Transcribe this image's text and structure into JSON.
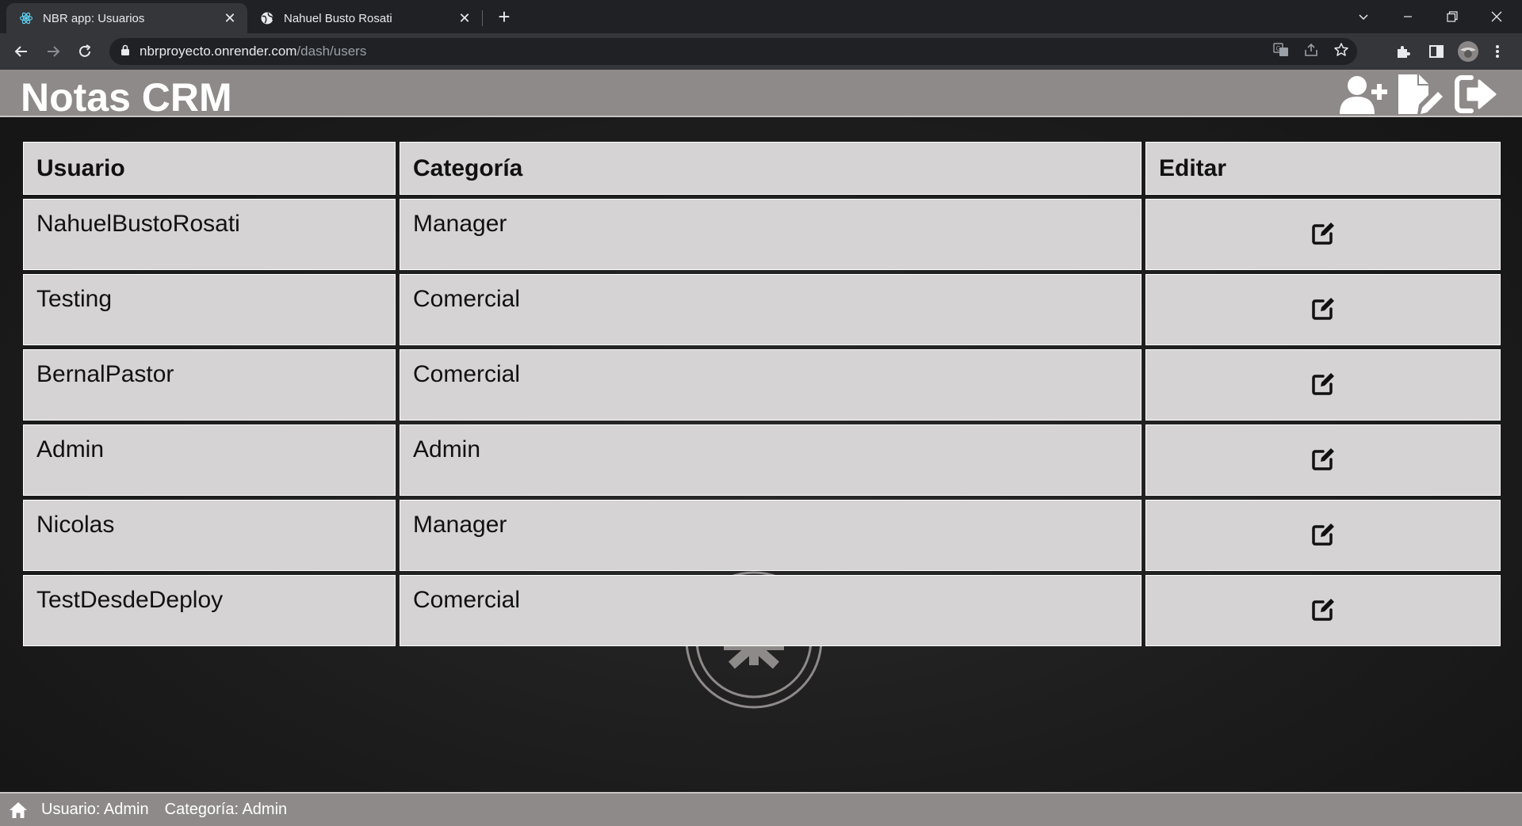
{
  "browser": {
    "tabs": [
      {
        "title": "NBR app: Usuarios",
        "active": true,
        "favicon": "react-icon"
      },
      {
        "title": "Nahuel Busto Rosati",
        "active": false,
        "favicon": "globe-icon"
      }
    ],
    "address": {
      "host": "nbrproyecto.onrender.com",
      "path": "/dash/users"
    }
  },
  "header": {
    "title": "Notas CRM",
    "buttons": [
      "add-user-icon",
      "new-note-icon",
      "logout-icon"
    ]
  },
  "table": {
    "columns": [
      "Usuario",
      "Categoría",
      "Editar"
    ],
    "rows": [
      {
        "usuario": "NahuelBustoRosati",
        "categoria": "Manager"
      },
      {
        "usuario": "Testing",
        "categoria": "Comercial"
      },
      {
        "usuario": "BernalPastor",
        "categoria": "Comercial"
      },
      {
        "usuario": "Admin",
        "categoria": "Admin"
      },
      {
        "usuario": "Nicolas",
        "categoria": "Manager"
      },
      {
        "usuario": "TestDesdeDeploy",
        "categoria": "Comercial"
      }
    ]
  },
  "footer": {
    "user_text": "Usuario: Admin",
    "category_text": "Categoría: Admin"
  },
  "colors": {
    "header_bg": "#8f8a8a",
    "cell_bg": "#d5d3d3",
    "page_bg": "#1b1b1b"
  }
}
